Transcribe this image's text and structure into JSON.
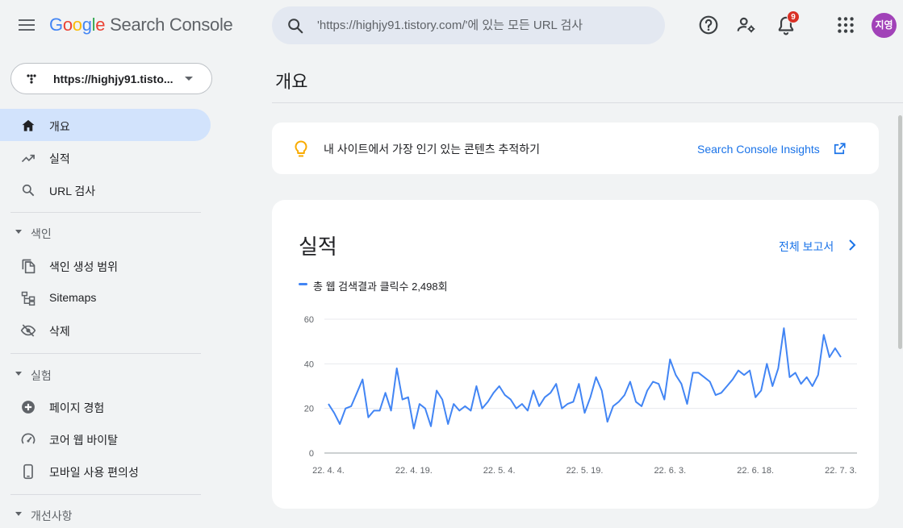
{
  "header": {
    "logo": {
      "G": "G",
      "o1": "o",
      "o2": "o",
      "g": "g",
      "l": "l",
      "e": "e",
      "product": "Search Console"
    },
    "search_placeholder": "'https://highjy91.tistory.com/'에 있는 모든 URL 검사",
    "notification_count": "9",
    "avatar_initials": "지영",
    "icons": [
      "menu-icon",
      "search-icon",
      "help-icon",
      "manage-users-icon",
      "notifications-icon",
      "apps-icon"
    ]
  },
  "sidebar": {
    "property": "https://highjy91.tisto...",
    "top_items": [
      {
        "label": "개요",
        "icon": "home-icon",
        "active": true
      },
      {
        "label": "실적",
        "icon": "trending-up-icon"
      },
      {
        "label": "URL 검사",
        "icon": "search-icon"
      }
    ],
    "sections": [
      {
        "title": "색인",
        "items": [
          {
            "label": "색인 생성 범위",
            "icon": "copy-icon"
          },
          {
            "label": "Sitemaps",
            "icon": "sitemap-icon"
          },
          {
            "label": "삭제",
            "icon": "hidden-eye-icon"
          }
        ]
      },
      {
        "title": "실험",
        "items": [
          {
            "label": "페이지 경험",
            "icon": "page-experience-icon"
          },
          {
            "label": "코어 웹 바이탈",
            "icon": "gauge-icon"
          },
          {
            "label": "모바일 사용 편의성",
            "icon": "mobile-icon"
          }
        ]
      },
      {
        "title": "개선사항",
        "items": []
      }
    ]
  },
  "main": {
    "title": "개요",
    "insight": {
      "text": "내 사이트에서 가장 인기 있는 콘텐츠 추적하기",
      "link": "Search Console Insights"
    },
    "performance": {
      "title": "실적",
      "report_link": "전체 보고서",
      "legend": "총 웹 검색결과 클릭수 2,498회"
    }
  },
  "colors": {
    "accent": "#1a73e8",
    "line": "#4285f4",
    "active_nav": "#d2e3fc",
    "badge": "#d93025",
    "avatar": "#a142b8",
    "bulb": "#f9ab00"
  },
  "chart_data": {
    "type": "line",
    "series": [
      {
        "name": "총 웹 검색결과 클릭수",
        "values": [
          22,
          18,
          13,
          20,
          21,
          27,
          33,
          16,
          19,
          19,
          27,
          19,
          38,
          24,
          25,
          11,
          22,
          20,
          12,
          28,
          24,
          13,
          22,
          19,
          21,
          19,
          30,
          20,
          23,
          27,
          30,
          26,
          24,
          20,
          22,
          19,
          28,
          21,
          25,
          27,
          31,
          20,
          22,
          23,
          31,
          18,
          25,
          34,
          28,
          14,
          21,
          23,
          26,
          32,
          23,
          21,
          28,
          32,
          31,
          24,
          42,
          35,
          31,
          22,
          36,
          36,
          34,
          32,
          26,
          27,
          30,
          33,
          37,
          35,
          37,
          25,
          28,
          40,
          30,
          38,
          56,
          34,
          36,
          31,
          34,
          30,
          35,
          53,
          43,
          47,
          43
        ]
      }
    ],
    "x_tick_labels": [
      "22. 4. 4.",
      "22. 4. 19.",
      "22. 5. 4.",
      "22. 5. 19.",
      "22. 6. 3.",
      "22. 6. 18.",
      "22. 7. 3."
    ],
    "x_tick_indices": [
      0,
      15,
      30,
      45,
      60,
      75,
      90
    ],
    "y_ticks": [
      0,
      20,
      40,
      60
    ],
    "ylim": [
      0,
      60
    ],
    "grid": true,
    "legend": "top-left"
  }
}
